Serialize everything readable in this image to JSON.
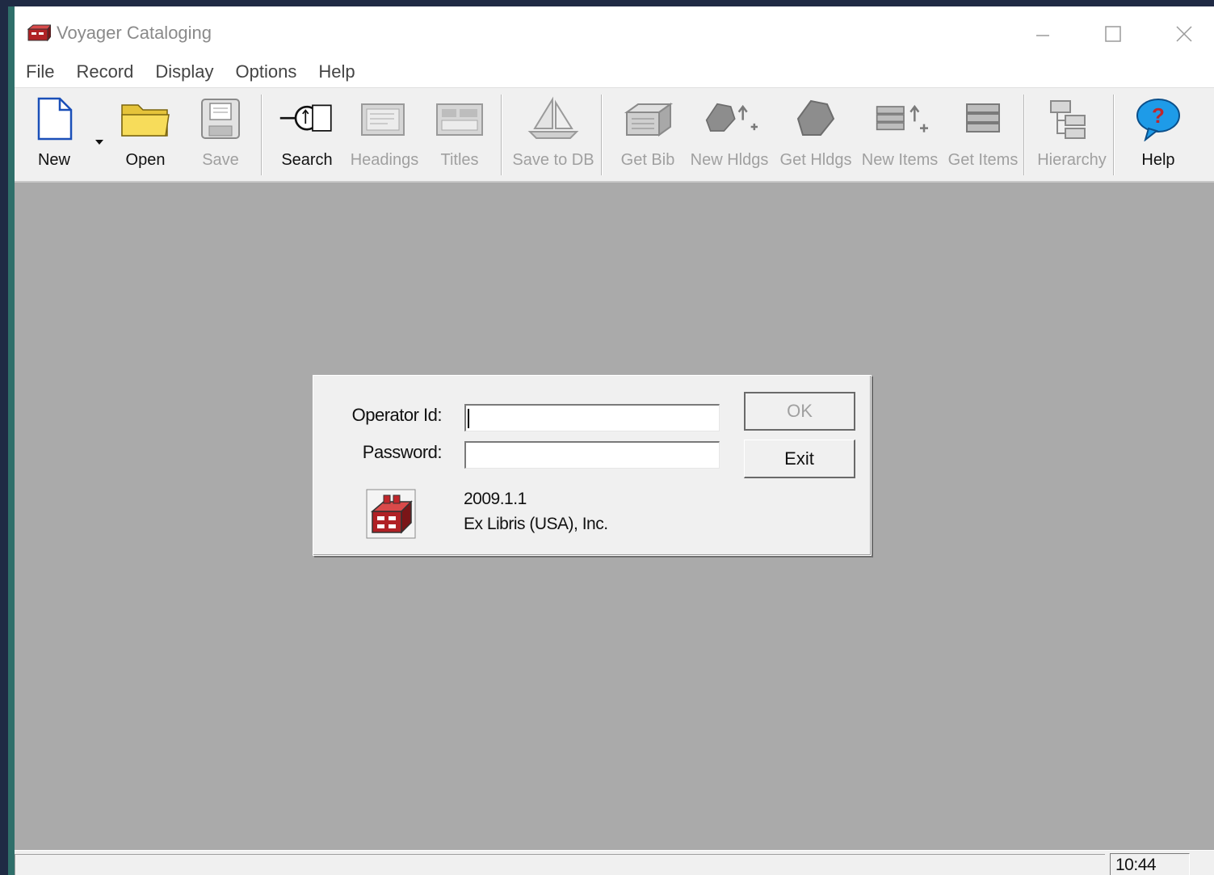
{
  "window": {
    "title": "Voyager Cataloging",
    "icon": "card-catalog-icon"
  },
  "menu": [
    "File",
    "Record",
    "Display",
    "Options",
    "Help"
  ],
  "toolbar": {
    "new_label": "New",
    "open_label": "Open",
    "save_label": "Save",
    "search_label": "Search",
    "headings_label": "Headings",
    "titles_label": "Titles",
    "save_to_db_label": "Save to DB",
    "get_bib_label": "Get Bib",
    "new_hldgs_label": "New Hldgs",
    "get_hldgs_label": "Get Hldgs",
    "new_items_label": "New Items",
    "get_items_label": "Get Items",
    "hierarchy_label": "Hierarchy",
    "help_label": "Help"
  },
  "login_dialog": {
    "operator_label": "Operator Id:",
    "operator_value": "",
    "password_label": "Password:",
    "password_value": "",
    "ok_label": "OK",
    "exit_label": "Exit",
    "version": "2009.1.1",
    "company": "Ex Libris (USA), Inc."
  },
  "statusbar": {
    "clock": "10:44 PM"
  },
  "colors": {
    "workspace": "#aaaaaa",
    "help_icon": "#1e9be8",
    "open_folder": "#f2d24a",
    "logo_red": "#c0262b"
  }
}
